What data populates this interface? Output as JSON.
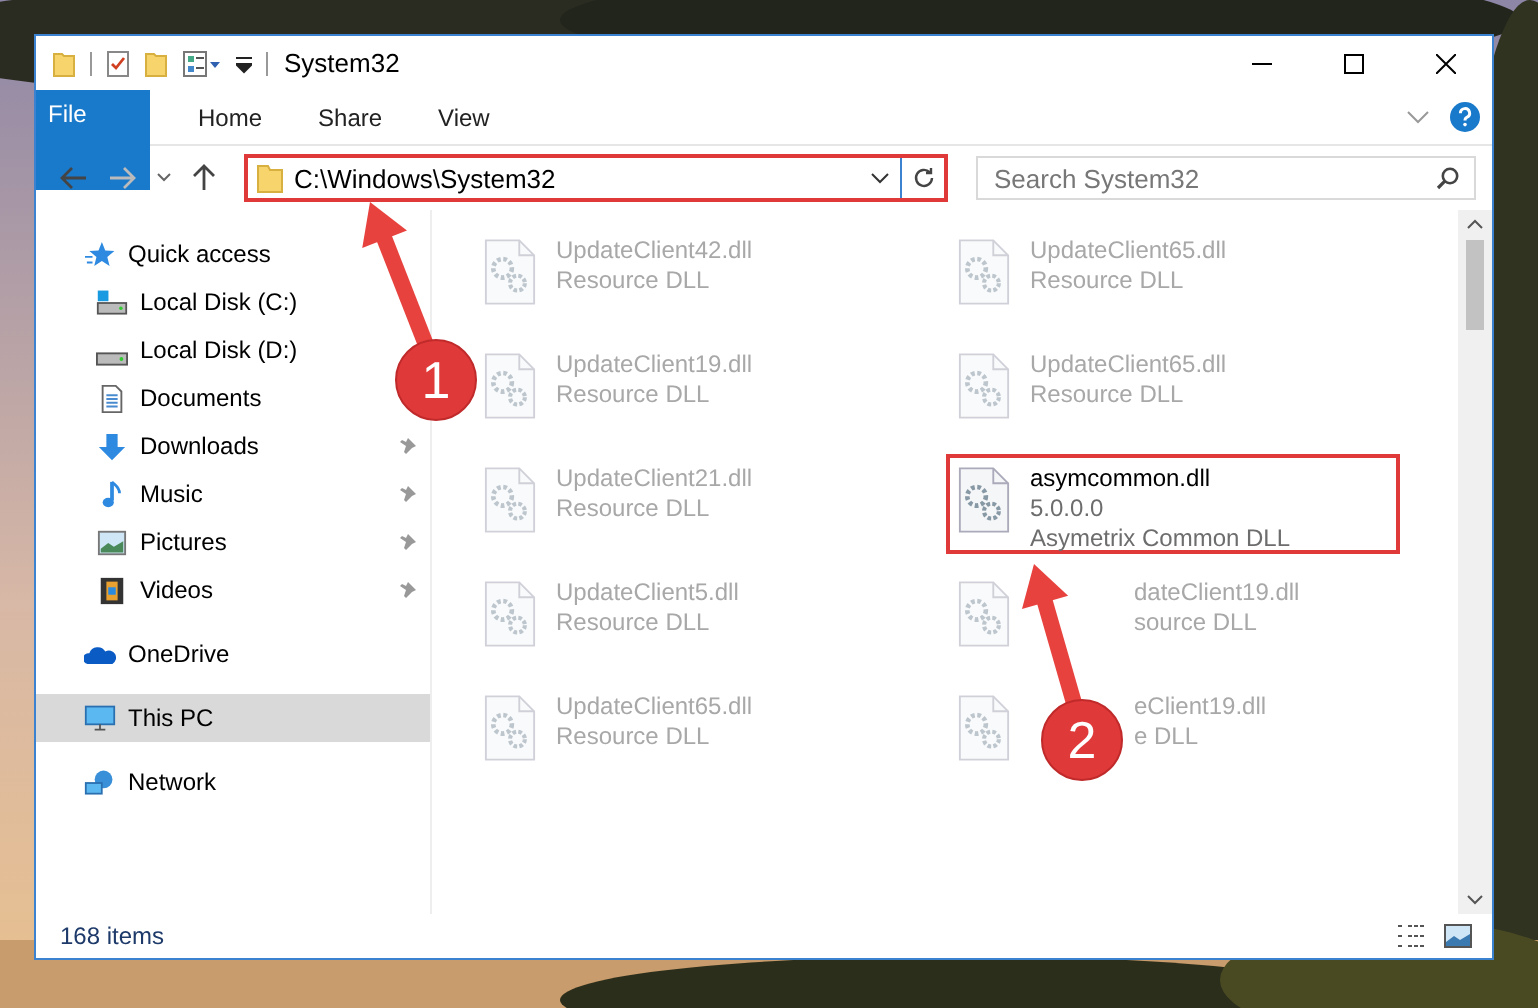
{
  "window": {
    "title": "System32"
  },
  "ribbon": {
    "tabs": [
      {
        "label": "File",
        "selected": true
      },
      {
        "label": "Home",
        "selected": false
      },
      {
        "label": "Share",
        "selected": false
      },
      {
        "label": "View",
        "selected": false
      }
    ]
  },
  "address": {
    "path": "C:\\Windows\\System32",
    "highlighted": true
  },
  "search": {
    "placeholder": "Search System32"
  },
  "sidebar": {
    "items": [
      {
        "label": "Quick access",
        "selected": false,
        "children": [
          {
            "label": "Local Disk (C:)",
            "pinned": false,
            "selected": false
          },
          {
            "label": "Local Disk (D:)",
            "pinned": false,
            "selected": false
          },
          {
            "label": "Documents",
            "pinned": false,
            "selected": false
          },
          {
            "label": "Downloads",
            "pinned": true,
            "selected": false
          },
          {
            "label": "Music",
            "pinned": true,
            "selected": false
          },
          {
            "label": "Pictures",
            "pinned": true,
            "selected": false
          },
          {
            "label": "Videos",
            "pinned": true,
            "selected": false
          }
        ]
      },
      {
        "label": "OneDrive",
        "selected": false
      },
      {
        "label": "This PC",
        "selected": true
      },
      {
        "label": "Network",
        "selected": false
      }
    ]
  },
  "files": [
    {
      "name": "UpdateClient42.dll",
      "description": "Resource DLL",
      "blurred": true,
      "highlighted": false,
      "covered": false
    },
    {
      "name": "UpdateClient65.dll",
      "description": "Resource DLL",
      "blurred": true,
      "highlighted": false,
      "covered": false
    },
    {
      "name": "UpdateClient19.dll",
      "description": "Resource DLL",
      "blurred": true,
      "highlighted": false,
      "covered": false
    },
    {
      "name": "UpdateClient65.dll",
      "description": "Resource DLL",
      "blurred": true,
      "highlighted": false,
      "covered": false
    },
    {
      "name": "UpdateClient21.dll",
      "description": "Resource DLL",
      "blurred": true,
      "highlighted": false,
      "covered": false
    },
    {
      "name": "asymcommon.dll",
      "version": "5.0.0.0",
      "description": "Asymetrix Common DLL",
      "blurred": false,
      "highlighted": true,
      "covered": false
    },
    {
      "name": "UpdateClient5.dll",
      "description": "Resource DLL",
      "blurred": true,
      "highlighted": false,
      "covered": false
    },
    {
      "name": "dateClient19.dll",
      "description": "source DLL",
      "blurred": true,
      "highlighted": false,
      "covered": true
    },
    {
      "name": "UpdateClient65.dll",
      "description": "Resource DLL",
      "blurred": true,
      "highlighted": false,
      "covered": false
    },
    {
      "name": "eClient19.dll",
      "description": "e DLL",
      "blurred": true,
      "highlighted": false,
      "covered": true
    }
  ],
  "status_bar": {
    "item_count": "168 items"
  },
  "annotations": [
    {
      "number": "1"
    },
    {
      "number": "2"
    }
  ]
}
